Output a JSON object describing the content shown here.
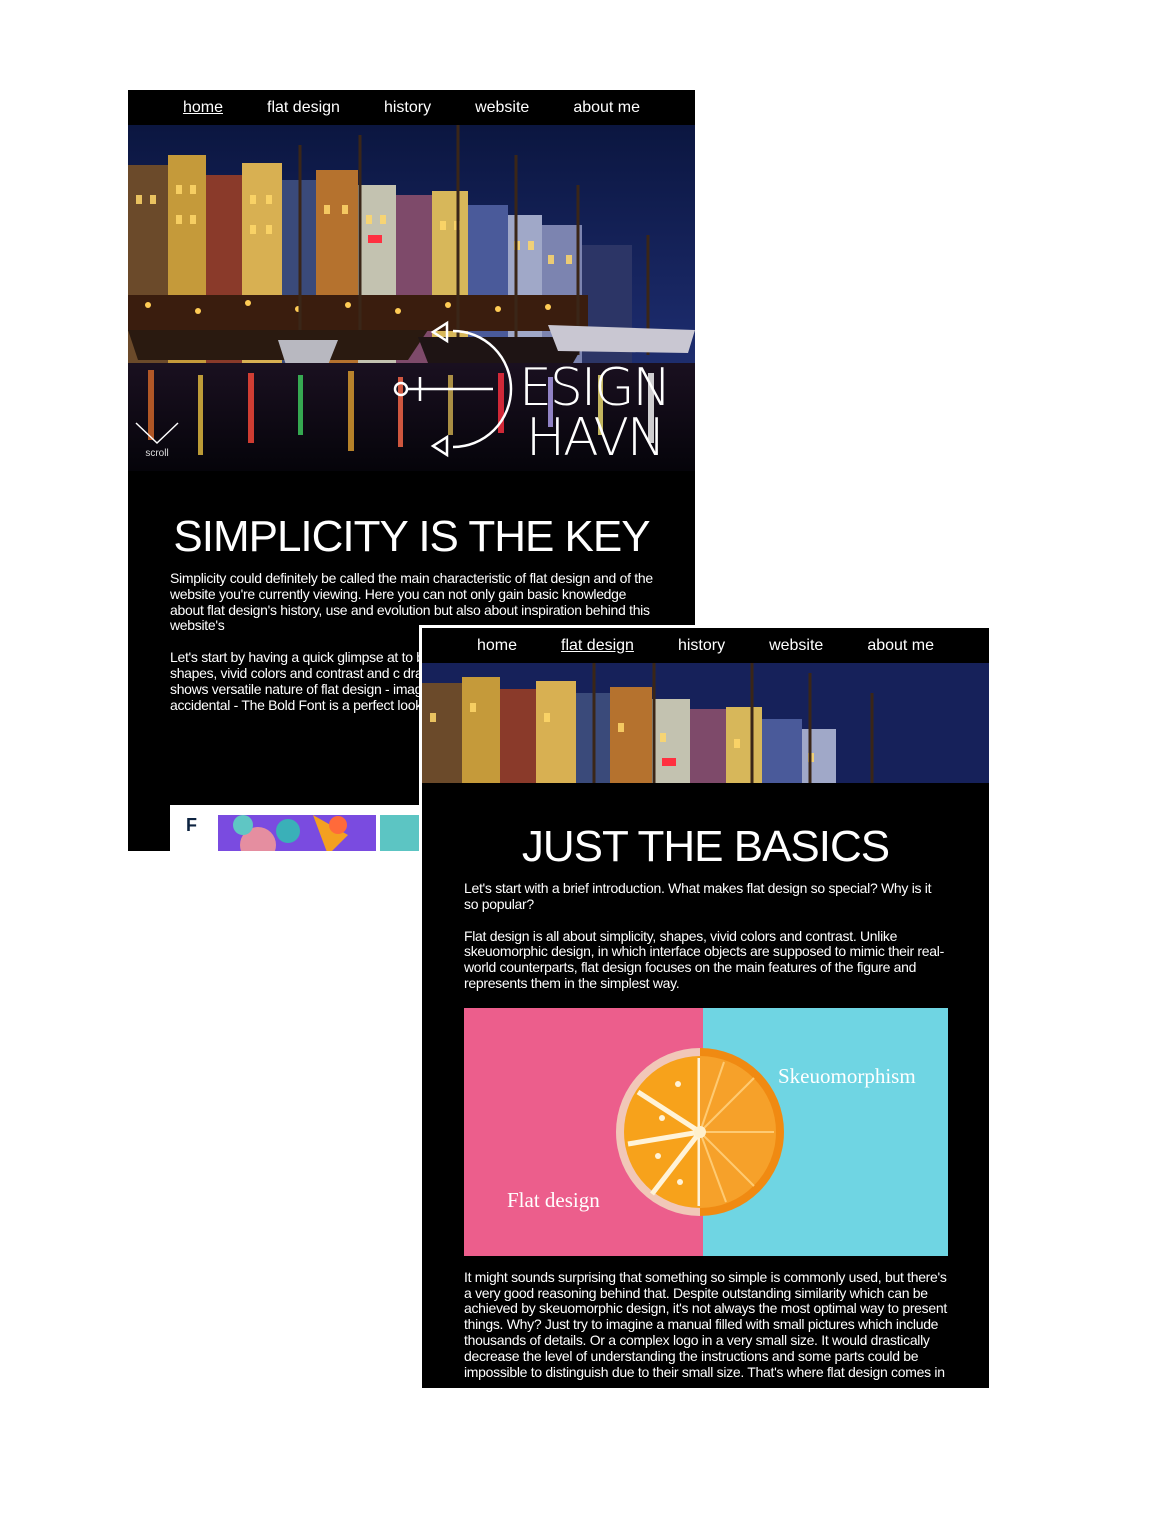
{
  "nav": {
    "items": [
      "home",
      "flat design",
      "history",
      "website",
      "about me"
    ]
  },
  "screen1": {
    "active_nav": "home",
    "logo": {
      "line1": "ESIGN",
      "line2": "HAVN"
    },
    "scroll_label": "scroll",
    "heading": "SIMPLICITY IS THE KEY",
    "paragraph1": "Simplicity could definitely be called the main characteristic of flat design and of the website you're currently viewing. Here you can not only gain basic knowledge about flat design's history, use and evolution but also about inspiration behind this website's",
    "paragraph2": "Let's start by having a quick glimpse at to be the essence of flat design's chara shapes, vivid colors and contrast and c draw attention - that's what this mood shows versatile nature of flat design - image, no matter if it's a landscape, por accidental - The Bold Font is a perfect look.",
    "thumb_letter": "F"
  },
  "screen2": {
    "active_nav": "flat design",
    "heading": "JUST THE BASICS",
    "paragraph1": "Let's start with a brief introduction. What makes flat design so special? Why is it so popular?",
    "paragraph2": "Flat design is all about simplicity, shapes, vivid colors and contrast. Unlike skeuomorphic design, in which interface objects are supposed to mimic their real-world counterparts, flat design focuses on the main features of the figure and represents them in the simplest way.",
    "image_label_left": "Flat design",
    "image_label_right": "Skeuomorphism",
    "paragraph3": "It might sounds surprising that something so simple is commonly used, but there's a very good reasoning behind that. Despite outstanding similarity which can be achieved by skeuomorphic design, it's not always the most optimal way to present things. Why? Just try to imagine a manual filled with small pictures which include thousands of details. Or a complex logo in a very small size. It would drastically decrease the level of understanding the instructions and some parts could be impossible to distinguish due to their small size. That's where flat design comes in"
  },
  "colors": {
    "page_bg": "#ffffff",
    "screen_bg": "#000000",
    "flat_pink": "#ec5e8c",
    "skeuo_cyan": "#6fd5e3",
    "orange": "#f7a21b"
  }
}
